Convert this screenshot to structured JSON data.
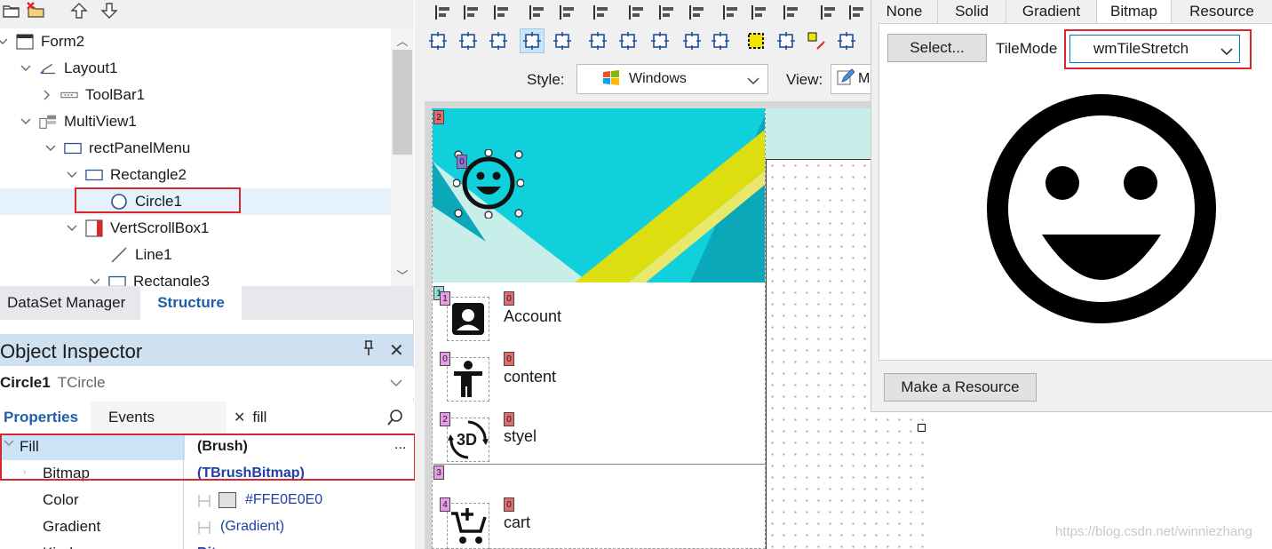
{
  "structure": {
    "tree": [
      {
        "label": "Form2",
        "icon": "form-icon",
        "depth": 0
      },
      {
        "label": "Layout1",
        "icon": "layout-icon",
        "depth": 1
      },
      {
        "label": "ToolBar1",
        "icon": "toolbar-icon",
        "depth": 2
      },
      {
        "label": "MultiView1",
        "icon": "multiview-icon",
        "depth": 1
      },
      {
        "label": "rectPanelMenu",
        "icon": "rectangle-icon",
        "depth": 2
      },
      {
        "label": "Rectangle2",
        "icon": "rectangle-icon",
        "depth": 3
      },
      {
        "label": "Circle1",
        "icon": "circle-icon",
        "depth": 4,
        "selected": true
      },
      {
        "label": "VertScrollBox1",
        "icon": "scrollbox-icon",
        "depth": 3
      },
      {
        "label": "Line1",
        "icon": "line-icon",
        "depth": 4
      },
      {
        "label": "Rectangle3",
        "icon": "rectangle-icon",
        "depth": 3
      }
    ]
  },
  "panel_tabs": {
    "dataset": "DataSet Manager",
    "structure": "Structure"
  },
  "object_inspector": {
    "title": "Object Inspector",
    "pin_glyph": "⇩",
    "close_glyph": "✕",
    "selected_name": "Circle1",
    "selected_type": "TCircle",
    "tab_properties": "Properties",
    "tab_events": "Events",
    "search_value": "fill",
    "properties": [
      {
        "name": "Fill",
        "value": "(Brush)",
        "extra": "..."
      },
      {
        "name": "Bitmap",
        "value": "(TBrushBitmap)"
      },
      {
        "name": "Color",
        "value": "#FFE0E0E0"
      },
      {
        "name": "Gradient",
        "value": "(Gradient)"
      },
      {
        "name": "Kind",
        "value": "Bitmap"
      }
    ],
    "color_swatch": "#E0E0E0"
  },
  "designer": {
    "style_label": "Style:",
    "style_value": "Windows",
    "view_label": "View:",
    "view_value": "M",
    "menu_items": [
      {
        "label": "Account",
        "icon": "account-box-icon"
      },
      {
        "label": "content",
        "icon": "person-icon"
      },
      {
        "label": "styel",
        "icon": "rotate-3d-icon"
      },
      {
        "label": "cart",
        "icon": "add-cart-icon"
      }
    ],
    "tags": {
      "banner": "2",
      "circle": "0",
      "group1": "1",
      "group3": "3",
      "account_icon": "1",
      "content_icon": "0",
      "styel_icon": "2",
      "cart_icon": "4",
      "label": "0"
    },
    "rotate_text": "3D",
    "colors": {
      "teal": "#10d0dc",
      "dark_teal": "#0aa8b8",
      "yellow": "#dcde10",
      "pale": "#c8eeea"
    }
  },
  "brush_editor": {
    "tabs": [
      "None",
      "Solid",
      "Gradient",
      "Bitmap",
      "Resource"
    ],
    "active_tab": "Bitmap",
    "select_button": "Select...",
    "tilemode_label": "TileMode",
    "tilemode_value": "wmTileStretch",
    "resource_button": "Make a Resource"
  },
  "watermark": "https://blog.csdn.net/winniezhang"
}
